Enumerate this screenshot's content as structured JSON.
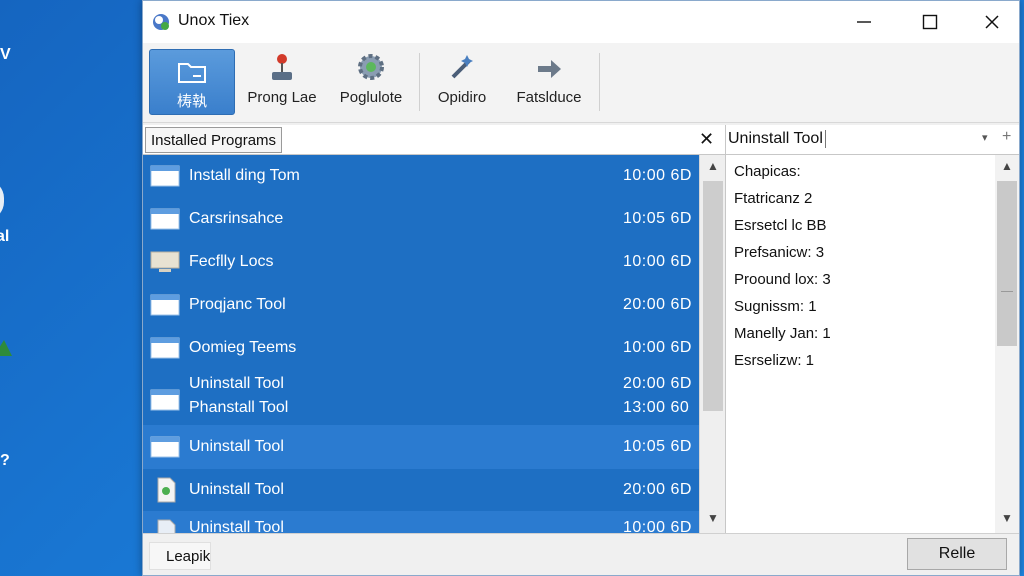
{
  "desktop": {
    "frag_v": "V",
    "frag_al": "al",
    "frag_q": "?"
  },
  "window": {
    "title": "Unox Tiex"
  },
  "toolbar": {
    "buttons": [
      {
        "label": "梼執",
        "icon": "folder-icon",
        "active": true
      },
      {
        "label": "Prong Lae",
        "icon": "joystick-icon"
      },
      {
        "label": "Poglulote",
        "icon": "gear-icon"
      },
      {
        "label": "Opidiro",
        "icon": "magic-wand-icon"
      },
      {
        "label": "Fatslduce",
        "icon": "arrow-right-icon"
      }
    ]
  },
  "left_pane": {
    "tab_label": "Installed Programs",
    "close_glyph": "✕",
    "rows": [
      {
        "name": "Install ding Tom",
        "time": "10:00 6D"
      },
      {
        "name": "Carsrinsahce",
        "time": "10:05 6D"
      },
      {
        "name": "Fecflly Locs",
        "time": "10:00 6D"
      },
      {
        "name": "Proqjanc Tool",
        "time": "20:00 6D"
      },
      {
        "name": "Oomieg Teems",
        "time": "10:00 6D"
      },
      {
        "name": "Uninstall Tool",
        "time": "20:00 6D"
      },
      {
        "name": "Phanstall Tool",
        "time": "13:00 60"
      },
      {
        "name": "Uninstall Tool",
        "time": "10:05 6D"
      },
      {
        "name": "Uninstall Tool",
        "time": "20:00 6D"
      },
      {
        "name": "Uninstall Tool",
        "time": "10:00 6D"
      }
    ]
  },
  "right_pane": {
    "title": "Uninstall Tool",
    "dropdown_glyph": "▾",
    "plus_glyph": "+",
    "details": [
      "Chapicas:",
      "Ftatricanz 2",
      "Esrsetcl lc BB",
      "Prefsanicw: 3",
      "Proound lox: 3",
      "Sugnissm: 1",
      "Manelly Jan: 1",
      "Esrselizw: 1"
    ]
  },
  "status_bar": {
    "left_label": "Leapik",
    "right_button": "Relle"
  },
  "colors": {
    "selection_blue": "#1e6fc3",
    "toolbar_active": "#4a8fd6"
  }
}
